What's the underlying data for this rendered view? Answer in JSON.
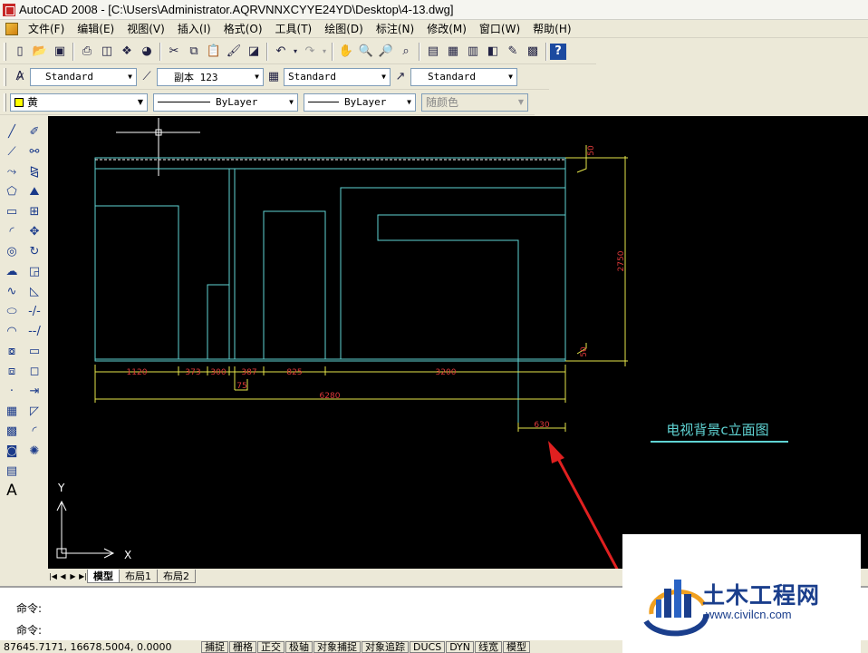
{
  "window": {
    "title": "AutoCAD 2008 - [C:\\Users\\Administrator.AQRVNNXCYYE24YD\\Desktop\\4-13.dwg]"
  },
  "menu": [
    "文件(F)",
    "编辑(E)",
    "视图(V)",
    "插入(I)",
    "格式(O)",
    "工具(T)",
    "绘图(D)",
    "标注(N)",
    "修改(M)",
    "窗口(W)",
    "帮助(H)"
  ],
  "styles": {
    "text_style": "Standard",
    "dim_style": "副本 123",
    "table_style": "Standard",
    "multileader_style": "Standard"
  },
  "properties": {
    "layer": "黄",
    "linetype": "ByLayer",
    "lineweight": "ByLayer",
    "plot_style": "随颜色"
  },
  "drawing": {
    "dimensions": {
      "d1120": "1120",
      "d373": "373",
      "d300": "300",
      "d387": "387",
      "d825": "825",
      "d3200": "3200",
      "d75": "75",
      "d6280": "6280",
      "d630": "630",
      "d2750": "2750",
      "d50a": "50",
      "d50b": "50"
    },
    "title": "电视背景c立面图",
    "ucs": {
      "x": "X",
      "y": "Y"
    },
    "colors": {
      "outline": "#5fd3d3",
      "dimension_line": "#e6e64a",
      "dimension_text": "#e03a3a",
      "title_text": "#5fd3d3",
      "arrow": "#e02020"
    }
  },
  "layout_tabs": [
    "模型",
    "布局1",
    "布局2"
  ],
  "command": {
    "line1": "命令:",
    "line2": "命令:"
  },
  "status": {
    "coords": "87645.7171, 16678.5004, 0.0000",
    "buttons": [
      "捕捉",
      "栅格",
      "正交",
      "极轴",
      "对象捕捉",
      "对象追踪",
      "DUCS",
      "DYN",
      "线宽",
      "模型"
    ]
  },
  "watermark": {
    "brand": "土木工程网",
    "url": "www.civilcn.com"
  }
}
